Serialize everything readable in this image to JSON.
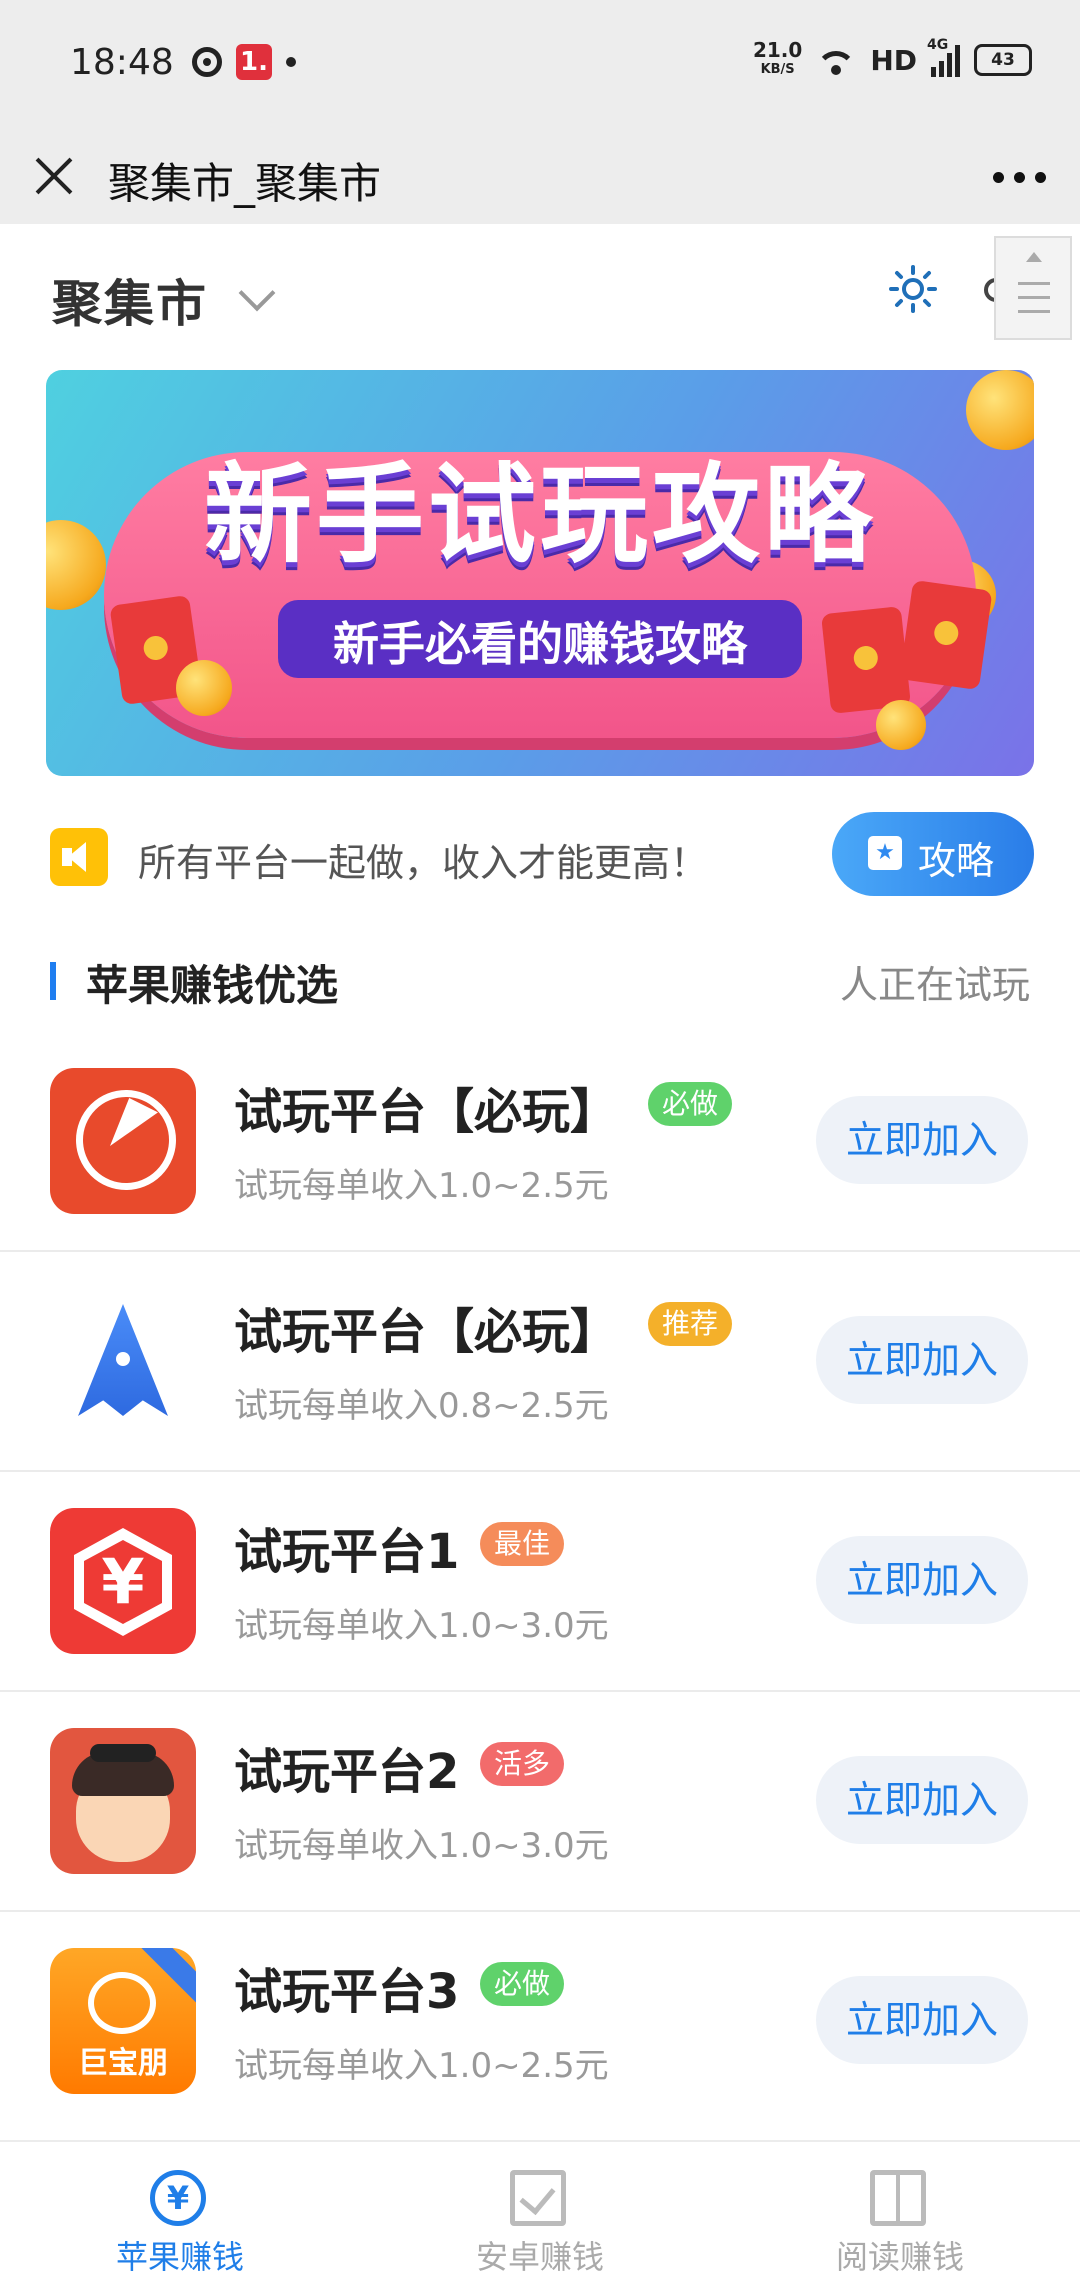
{
  "status_bar": {
    "time": "18:48",
    "notif_badge": "1.",
    "speed_value": "21.0",
    "speed_unit": "KB/S",
    "hd": "HD",
    "network": "4G",
    "battery": "43"
  },
  "title_bar": {
    "title": "聚集市_聚集市"
  },
  "header": {
    "market_name": "聚集市"
  },
  "banner": {
    "title": "新手试玩攻略",
    "subtitle": "新手必看的赚钱攻略"
  },
  "notice": {
    "text": "所有平台一起做，收入才能更高！",
    "button_label": "攻略"
  },
  "section": {
    "title": "苹果赚钱优选",
    "right_text": "人正在试玩"
  },
  "apps": [
    {
      "name": "试玩平台【必玩】",
      "badge": "必做",
      "badge_color": "#5fd26b",
      "desc": "试玩每单收入1.0~2.5元",
      "button": "立即加入",
      "icon": "pie-clock-icon"
    },
    {
      "name": "试玩平台【必玩】",
      "badge": "推荐",
      "badge_color": "#f4b02a",
      "desc": "试玩每单收入0.8~2.5元",
      "button": "立即加入",
      "icon": "rocket-icon"
    },
    {
      "name": "试玩平台1",
      "badge": "最佳",
      "badge_color": "#f58c5a",
      "desc": "试玩每单收入1.0~3.0元",
      "button": "立即加入",
      "icon": "yen-hexagon-icon"
    },
    {
      "name": "试玩平台2",
      "badge": "活多",
      "badge_color": "#f26b6b",
      "desc": "试玩每单收入1.0~3.0元",
      "button": "立即加入",
      "icon": "cartoon-face-icon"
    },
    {
      "name": "试玩平台3",
      "badge": "必做",
      "badge_color": "#5fd26b",
      "desc": "试玩每单收入1.0~2.5元",
      "button": "立即加入",
      "icon": "jbp-logo-icon",
      "icon_text": "巨宝朋"
    }
  ],
  "bottom_nav": [
    {
      "label": "苹果赚钱",
      "icon": "yen-coin-icon",
      "active": true
    },
    {
      "label": "安卓赚钱",
      "icon": "checkbox-icon",
      "active": false
    },
    {
      "label": "阅读赚钱",
      "icon": "book-icon",
      "active": false
    }
  ],
  "colors": {
    "accent": "#1f7ee8",
    "status_bg": "#ededed",
    "button_bg": "#eef2f8"
  }
}
